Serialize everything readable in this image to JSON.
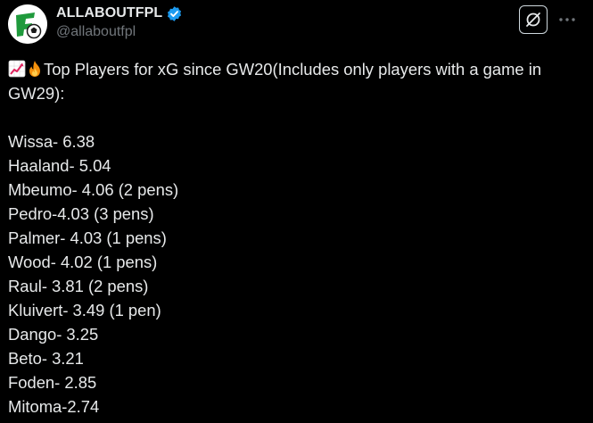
{
  "post": {
    "author": {
      "display_name": "ALLABOUTFPL",
      "handle": "@allaboutfpl",
      "verified": true,
      "verified_color": "#1d9bf0"
    },
    "icons": {
      "avatar": "football-logo-avatar",
      "verified": "verified-badge-icon",
      "grok": "grok-icon",
      "more": "more-options-icon",
      "emoji_1": "chart-increasing-emoji",
      "emoji_2": "fire-emoji"
    },
    "headline_text": "Top Players for xG since GW20(Includes only players with a game in GW29):",
    "players": [
      "Wissa- 6.38",
      "Haaland- 5.04",
      "Mbeumo- 4.06 (2 pens)",
      "Pedro-4.03 (3 pens)",
      "Palmer- 4.03 (1 pens)",
      "Wood- 4.02 (1 pens)",
      "Raul- 3.81 (2 pens)",
      "Kluivert- 3.49 (1 pen)",
      "Dango- 3.25",
      "Beto- 3.21",
      "Foden- 2.85",
      "Mitoma-2.74"
    ]
  }
}
